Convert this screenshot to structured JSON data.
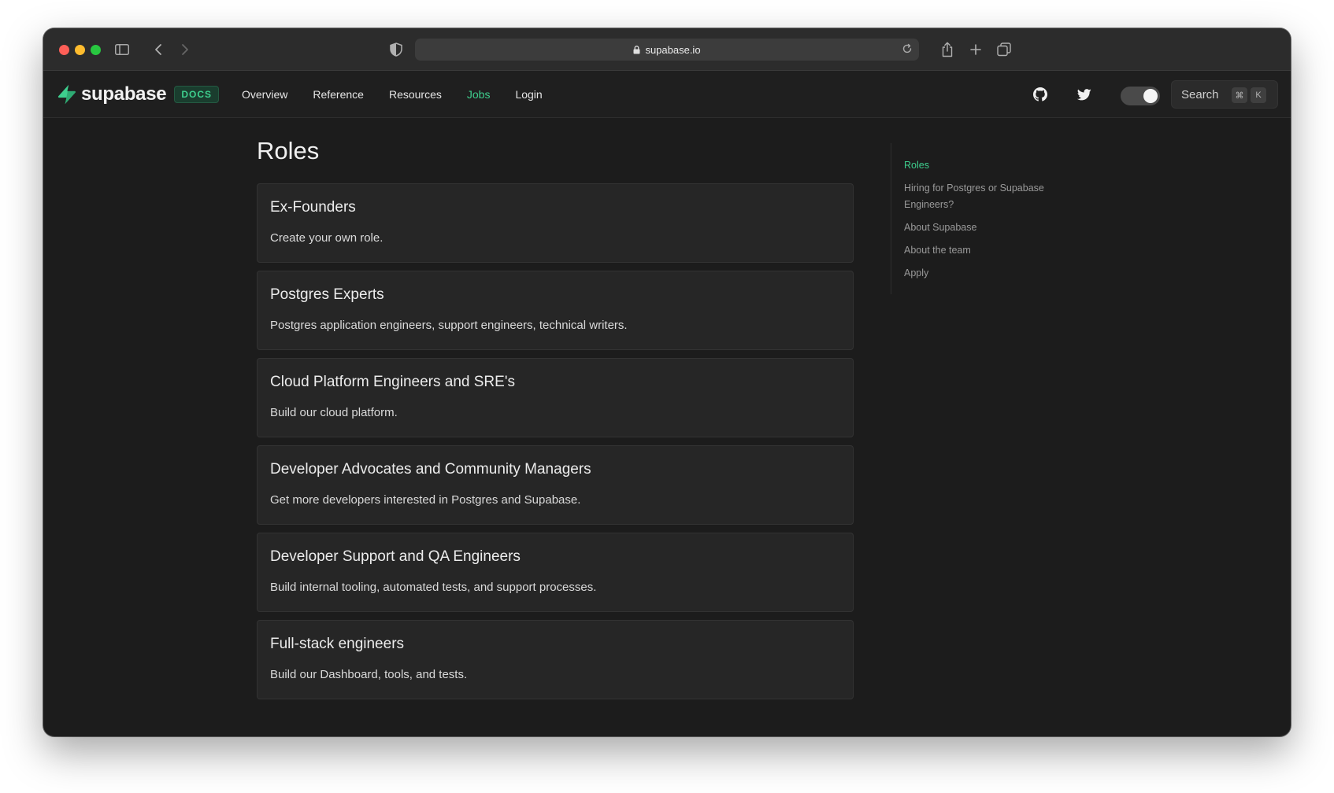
{
  "browser": {
    "url": "supabase.io"
  },
  "nav": {
    "logo_text": "supabase",
    "badge": "DOCS",
    "links": [
      {
        "label": "Overview",
        "active": false
      },
      {
        "label": "Reference",
        "active": false
      },
      {
        "label": "Resources",
        "active": false
      },
      {
        "label": "Jobs",
        "active": true
      },
      {
        "label": "Login",
        "active": false
      }
    ],
    "search_label": "Search",
    "search_keys": [
      "⌘",
      "K"
    ],
    "icons": [
      "github-icon",
      "twitter-icon"
    ],
    "accent_color": "#3ecf8e"
  },
  "main": {
    "title": "Roles",
    "roles": [
      {
        "title": "Ex-Founders",
        "description": "Create your own role."
      },
      {
        "title": "Postgres Experts",
        "description": "Postgres application engineers, support engineers, technical writers."
      },
      {
        "title": "Cloud Platform Engineers and SRE's",
        "description": "Build our cloud platform."
      },
      {
        "title": "Developer Advocates and Community Managers",
        "description": "Get more developers interested in Postgres and Supabase."
      },
      {
        "title": "Developer Support and QA Engineers",
        "description": "Build internal tooling, automated tests, and support processes."
      },
      {
        "title": "Full-stack engineers",
        "description": "Build our Dashboard, tools, and tests."
      }
    ]
  },
  "toc": {
    "items": [
      {
        "label": "Roles",
        "active": true
      },
      {
        "label": "Hiring for Postgres or Supabase Engineers?",
        "active": false
      },
      {
        "label": "About Supabase",
        "active": false
      },
      {
        "label": "About the team",
        "active": false
      },
      {
        "label": "Apply",
        "active": false
      }
    ]
  }
}
